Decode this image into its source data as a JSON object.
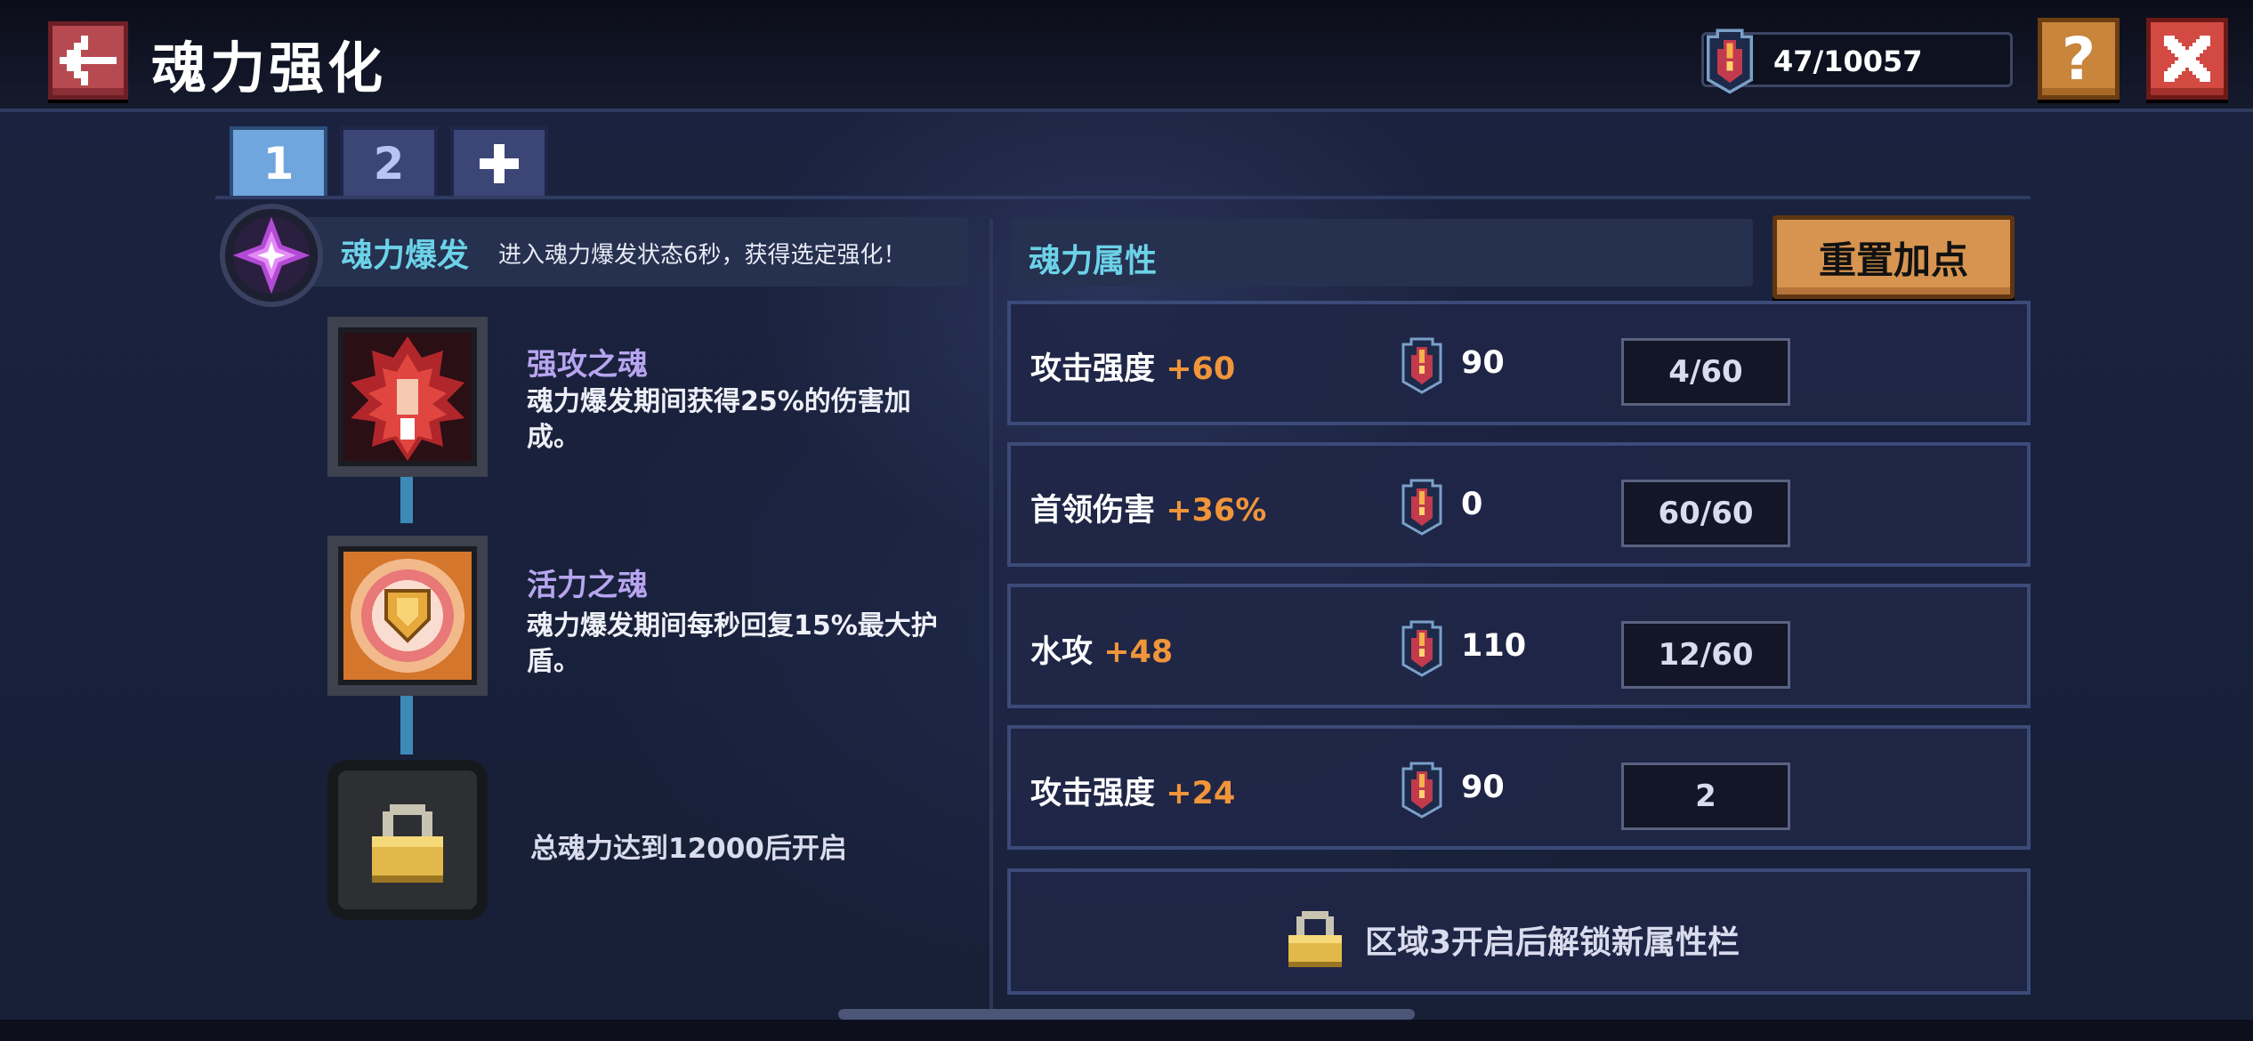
{
  "header": {
    "title": "魂力强化",
    "currency_value": "47/10057",
    "help_label": "?"
  },
  "tabs": [
    {
      "label": "1",
      "active": true
    },
    {
      "label": "2",
      "active": false
    },
    {
      "label": "+",
      "active": false
    }
  ],
  "burst": {
    "title": "魂力爆发",
    "description": "进入魂力爆发状态6秒，获得选定强化！"
  },
  "skills": [
    {
      "name": "强攻之魂",
      "description": "魂力爆发期间获得25%的伤害加成。",
      "icon": "strike-soul-icon"
    },
    {
      "name": "活力之魂",
      "description": "魂力爆发期间每秒回复15%最大护盾。",
      "icon": "vitality-soul-icon"
    }
  ],
  "locked_skill": {
    "text": "总魂力达到12000后开启"
  },
  "attributes": {
    "title": "魂力属性",
    "reset_label": "重置加点",
    "rows": [
      {
        "name": "攻击强度",
        "bonus": "+60",
        "cost": "90",
        "level": "4/60"
      },
      {
        "name": "首领伤害",
        "bonus": "+36%",
        "cost": "0",
        "level": "60/60"
      },
      {
        "name": "水攻",
        "bonus": "+48",
        "cost": "110",
        "level": "12/60"
      },
      {
        "name": "攻击强度",
        "bonus": "+24",
        "cost": "90",
        "level": "2"
      }
    ],
    "locked_text": "区域3开启后解锁新属性栏"
  },
  "colors": {
    "accent_cyan": "#6cd2e8",
    "bonus_orange": "#f0953a",
    "skill_purple": "#b7a5f0",
    "reset_button": "#d69450",
    "close_button": "#d24a42",
    "help_button": "#c9853c"
  }
}
